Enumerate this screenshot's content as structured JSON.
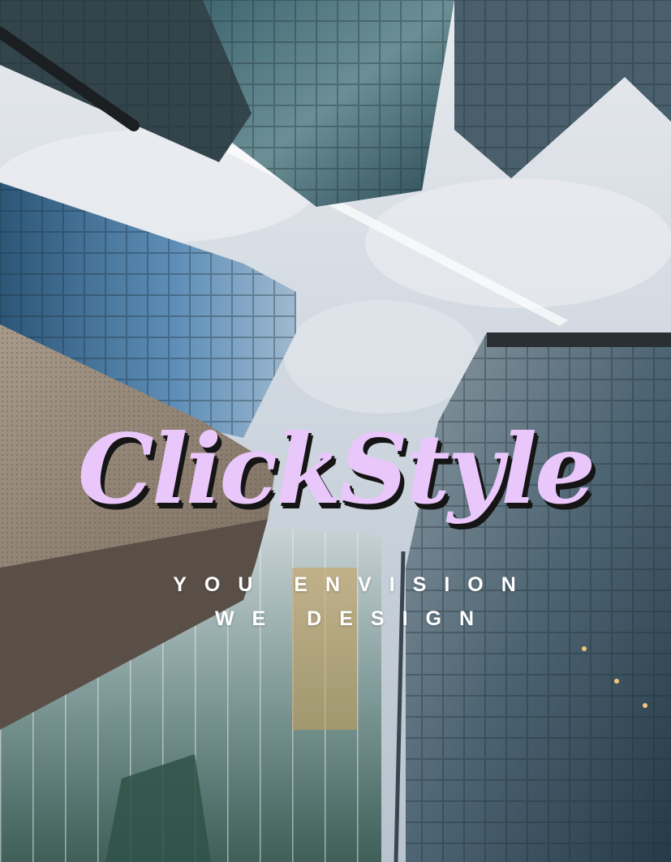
{
  "poster": {
    "brand_name": "ClickStyle",
    "tagline_line1": "YOU ENVISION",
    "tagline_line2": "WE DESIGN"
  },
  "colors": {
    "brand_text": "#e9c7fb",
    "brand_shadow": "#151515",
    "tagline_text": "#ffffff",
    "sky": "#d5dbe2"
  }
}
